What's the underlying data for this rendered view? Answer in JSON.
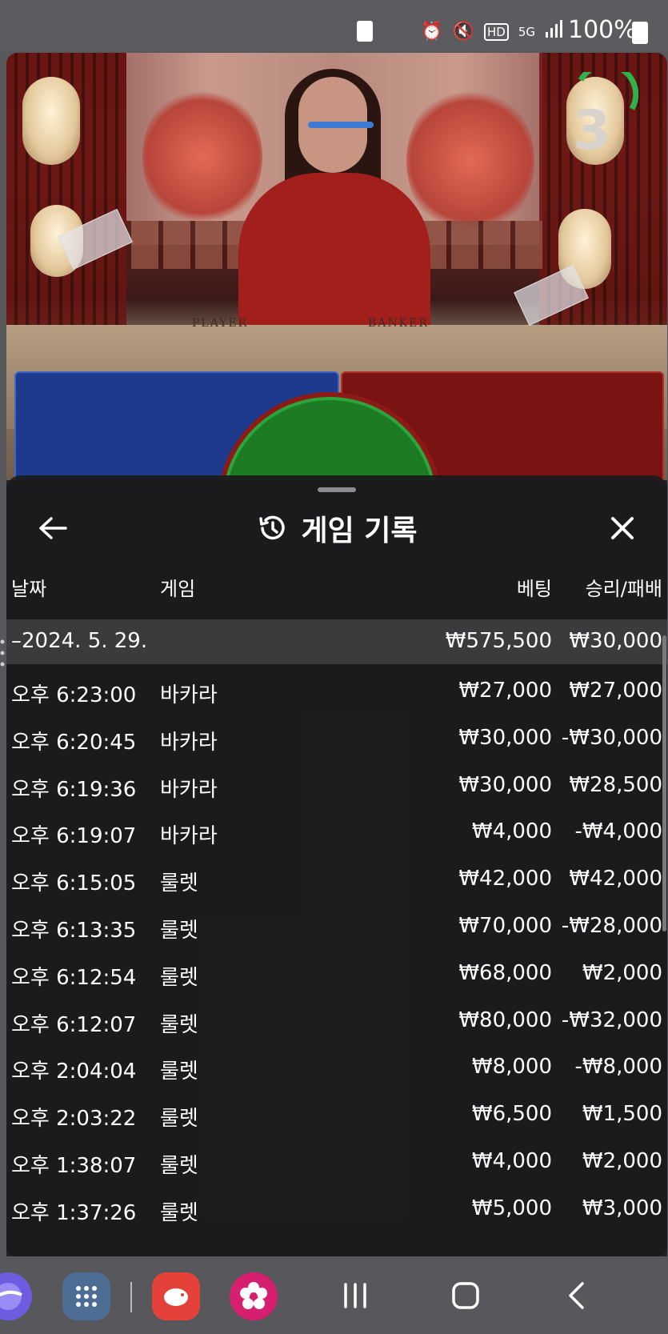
{
  "status_bar": {
    "battery_percent": "100%",
    "icons": [
      "battery-saver-icon",
      "alarm-icon",
      "mute-icon",
      "hd-icon",
      "5g-icon",
      "signal-icon",
      "battery-icon"
    ],
    "hd_label": "HD",
    "net_label": "5G"
  },
  "video": {
    "countdown": "3",
    "table_player_label": "PLAYER",
    "table_banker_label": "BANKER",
    "player_color": "#1d3a8c",
    "banker_color": "#7a1412",
    "tie_color": "#1d7a25"
  },
  "sheet": {
    "title": "게임 기록",
    "title_icon": "history-icon",
    "back_icon": "arrow-left-icon",
    "close_icon": "close-icon",
    "columns": {
      "date": "날짜",
      "game": "게임",
      "bet": "베팅",
      "result": "승리/패배"
    },
    "date_group": {
      "label": "–2024. 5. 29.",
      "bet_total": "₩575,500",
      "result_total": "₩30,000"
    },
    "rows": [
      {
        "time": "오후 6:23:00",
        "game": "바카라",
        "bet": "₩27,000",
        "result": "₩27,000"
      },
      {
        "time": "오후 6:20:45",
        "game": "바카라",
        "bet": "₩30,000",
        "result": "-₩30,000"
      },
      {
        "time": "오후 6:19:36",
        "game": "바카라",
        "bet": "₩30,000",
        "result": "₩28,500"
      },
      {
        "time": "오후 6:19:07",
        "game": "바카라",
        "bet": "₩4,000",
        "result": "-₩4,000"
      },
      {
        "time": "오후 6:15:05",
        "game": "룰렛",
        "bet": "₩42,000",
        "result": "₩42,000"
      },
      {
        "time": "오후 6:13:35",
        "game": "룰렛",
        "bet": "₩70,000",
        "result": "-₩28,000"
      },
      {
        "time": "오후 6:12:54",
        "game": "룰렛",
        "bet": "₩68,000",
        "result": "₩2,000"
      },
      {
        "time": "오후 6:12:07",
        "game": "룰렛",
        "bet": "₩80,000",
        "result": "-₩32,000"
      },
      {
        "time": "오후 2:04:04",
        "game": "룰렛",
        "bet": "₩8,000",
        "result": "-₩8,000"
      },
      {
        "time": "오후 2:03:22",
        "game": "룰렛",
        "bet": "₩6,500",
        "result": "₩1,500"
      },
      {
        "time": "오후 1:38:07",
        "game": "룰렛",
        "bet": "₩4,000",
        "result": "₩2,000"
      },
      {
        "time": "오후 1:37:26",
        "game": "룰렛",
        "bet": "₩5,000",
        "result": "₩3,000"
      }
    ]
  },
  "navbar": {
    "apps": [
      "internet-app-icon",
      "apps-grid-icon",
      "piggy-bank-app-icon",
      "flower-app-icon"
    ],
    "buttons": [
      "recents-icon",
      "home-icon",
      "back-icon"
    ]
  }
}
